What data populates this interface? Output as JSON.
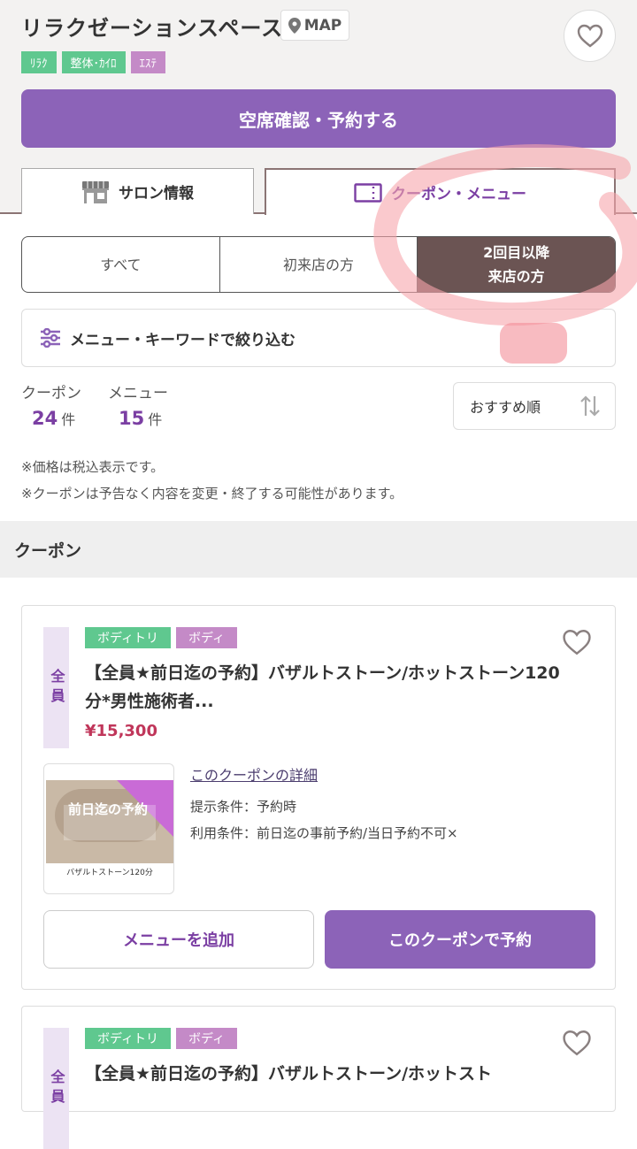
{
  "header": {
    "title": "リラクゼーションスペース",
    "map_label": "MAP",
    "tags": [
      {
        "label": "ﾘﾗｸ",
        "color": "#5fc88f"
      },
      {
        "label": "整体･ｶｲﾛ",
        "color": "#5fc88f"
      },
      {
        "label": "ｴｽﾃ",
        "color": "#c48ac7"
      }
    ],
    "reserve_label": "空席確認・予約する"
  },
  "tabs": {
    "salon": "サロン情報",
    "coupon": "クーポン・メニュー",
    "active": "coupon"
  },
  "segments": [
    {
      "label": "すべて",
      "active": false
    },
    {
      "label": "初来店の方",
      "active": false
    },
    {
      "label": "2回目以降\n来店の方",
      "active": true
    }
  ],
  "filter_label": "メニュー・キーワードで絞り込む",
  "counts": {
    "coupon_label": "クーポン",
    "coupon_count": "24",
    "menu_label": "メニュー",
    "menu_count": "15",
    "unit": "件"
  },
  "sort_label": "おすすめ順",
  "notes": [
    "※価格は税込表示です。",
    "※クーポンは予告なく内容を変更・終了する可能性があります。"
  ],
  "section_title": "クーポン",
  "coupons": [
    {
      "target": "全員",
      "tags": [
        {
          "label": "ボディトリ",
          "color": "#5fc88f"
        },
        {
          "label": "ボディ",
          "color": "#c48ac7"
        }
      ],
      "title": "【全員★前日迄の予約】バザルトストーン/ホットストーン120分*男性施術者...",
      "price": "¥15,300",
      "thumb_text": "前日迄の予約",
      "thumb_caption": "バザルトストーン120分",
      "detail_link": "このクーポンの詳細",
      "present_condition": "提示条件：予約時",
      "use_condition": "利用条件：前日迄の事前予約/当日予約不可×",
      "add_menu_label": "メニューを追加",
      "reserve_label": "このクーポンで予約"
    },
    {
      "target": "全員",
      "tags": [
        {
          "label": "ボディトリ",
          "color": "#5fc88f"
        },
        {
          "label": "ボディ",
          "color": "#c48ac7"
        }
      ],
      "title": "【全員★前日迄の予約】バザルトストーン/ホットスト"
    }
  ]
}
